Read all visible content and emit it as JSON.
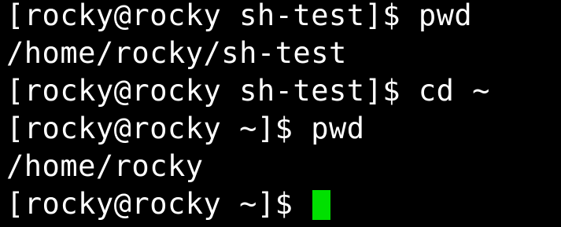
{
  "terminal": {
    "colors": {
      "background": "#000000",
      "text": "#ffffff",
      "cursor": "#00e000"
    },
    "lines": [
      {
        "prompt": "[rocky@rocky sh-test]$ ",
        "command": "pwd"
      },
      {
        "output": "/home/rocky/sh-test"
      },
      {
        "prompt": "[rocky@rocky sh-test]$ ",
        "command": "cd ~"
      },
      {
        "prompt": "[rocky@rocky ~]$ ",
        "command": "pwd"
      },
      {
        "output": "/home/rocky"
      },
      {
        "prompt": "[rocky@rocky ~]$ ",
        "command": ""
      }
    ]
  }
}
